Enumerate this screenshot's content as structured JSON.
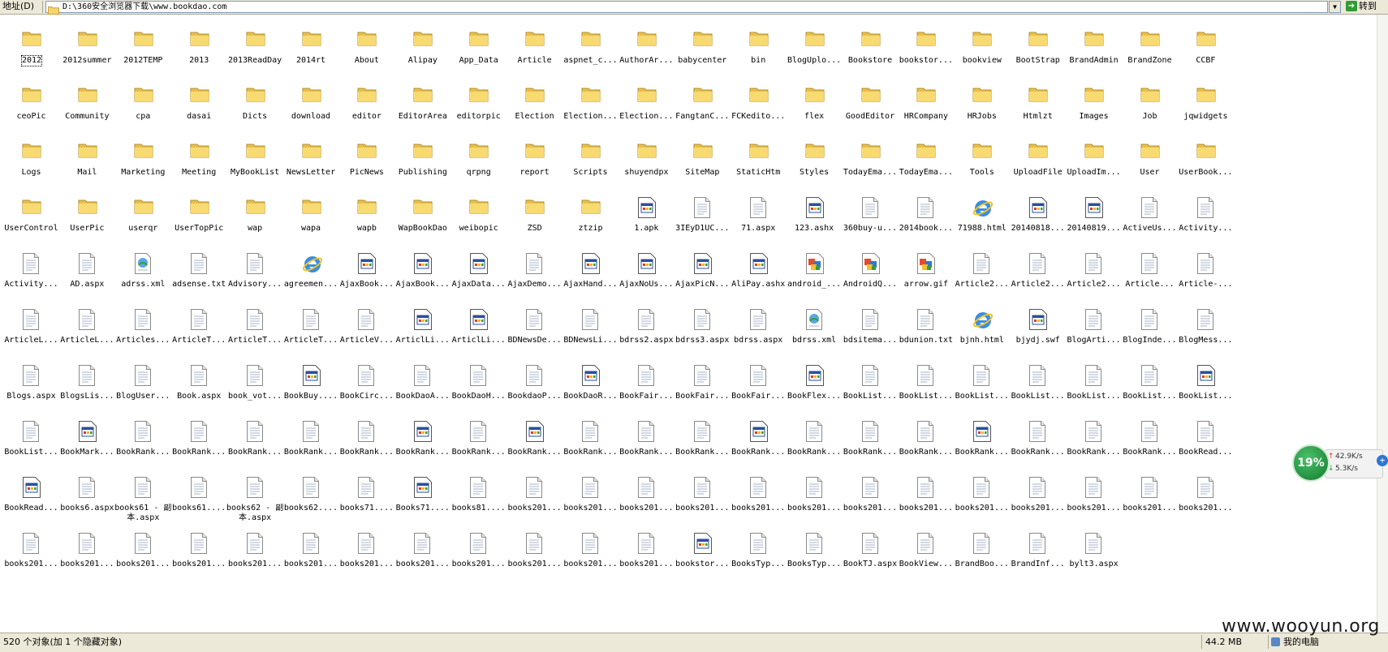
{
  "address_bar": {
    "label": "地址(D)",
    "path": "D:\\360安全浏览器下载\\www.bookdao.com",
    "goto_label": "转到",
    "dropdown_glyph": "▼",
    "goto_glyph": "➔"
  },
  "files": [
    {
      "name": "2012",
      "type": "folder"
    },
    {
      "name": "2012summer",
      "type": "folder"
    },
    {
      "name": "2012TEMP",
      "type": "folder"
    },
    {
      "name": "2013",
      "type": "folder"
    },
    {
      "name": "2013ReadDay",
      "type": "folder"
    },
    {
      "name": "2014rt",
      "type": "folder"
    },
    {
      "name": "About",
      "type": "folder"
    },
    {
      "name": "Alipay",
      "type": "folder"
    },
    {
      "name": "App_Data",
      "type": "folder"
    },
    {
      "name": "Article",
      "type": "folder"
    },
    {
      "name": "aspnet_c...",
      "type": "folder"
    },
    {
      "name": "AuthorAr...",
      "type": "folder"
    },
    {
      "name": "babycenter",
      "type": "folder"
    },
    {
      "name": "bin",
      "type": "folder"
    },
    {
      "name": "BlogUplo...",
      "type": "folder"
    },
    {
      "name": "Bookstore",
      "type": "folder"
    },
    {
      "name": "bookstor...",
      "type": "folder"
    },
    {
      "name": "bookview",
      "type": "folder"
    },
    {
      "name": "BootStrap",
      "type": "folder"
    },
    {
      "name": "BrandAdmin",
      "type": "folder"
    },
    {
      "name": "BrandZone",
      "type": "folder"
    },
    {
      "name": "CCBF",
      "type": "folder"
    },
    {
      "name": "ceoPic",
      "type": "folder"
    },
    {
      "name": "Community",
      "type": "folder"
    },
    {
      "name": "cpa",
      "type": "folder"
    },
    {
      "name": "dasai",
      "type": "folder"
    },
    {
      "name": "Dicts",
      "type": "folder"
    },
    {
      "name": "download",
      "type": "folder"
    },
    {
      "name": "editor",
      "type": "folder"
    },
    {
      "name": "EditorArea",
      "type": "folder"
    },
    {
      "name": "editorpic",
      "type": "folder"
    },
    {
      "name": "Election",
      "type": "folder"
    },
    {
      "name": "Election...",
      "type": "folder"
    },
    {
      "name": "Election...",
      "type": "folder"
    },
    {
      "name": "FangtanC...",
      "type": "folder"
    },
    {
      "name": "FCKedito...",
      "type": "folder"
    },
    {
      "name": "flex",
      "type": "folder"
    },
    {
      "name": "GoodEditor",
      "type": "folder"
    },
    {
      "name": "HRCompany",
      "type": "folder"
    },
    {
      "name": "HRJobs",
      "type": "folder"
    },
    {
      "name": "Htmlzt",
      "type": "folder"
    },
    {
      "name": "Images",
      "type": "folder"
    },
    {
      "name": "Job",
      "type": "folder"
    },
    {
      "name": "jqwidgets",
      "type": "folder"
    },
    {
      "name": "Logs",
      "type": "folder"
    },
    {
      "name": "Mail",
      "type": "folder"
    },
    {
      "name": "Marketing",
      "type": "folder"
    },
    {
      "name": "Meeting",
      "type": "folder"
    },
    {
      "name": "MyBookList",
      "type": "folder"
    },
    {
      "name": "NewsLetter",
      "type": "folder"
    },
    {
      "name": "PicNews",
      "type": "folder"
    },
    {
      "name": "Publishing",
      "type": "folder"
    },
    {
      "name": "qrpng",
      "type": "folder"
    },
    {
      "name": "report",
      "type": "folder"
    },
    {
      "name": "Scripts",
      "type": "folder"
    },
    {
      "name": "shuyendpx",
      "type": "folder"
    },
    {
      "name": "SiteMap",
      "type": "folder"
    },
    {
      "name": "StaticHtm",
      "type": "folder"
    },
    {
      "name": "Styles",
      "type": "folder"
    },
    {
      "name": "TodayEma...",
      "type": "folder"
    },
    {
      "name": "TodayEma...",
      "type": "folder"
    },
    {
      "name": "Tools",
      "type": "folder"
    },
    {
      "name": "UploadFile",
      "type": "folder"
    },
    {
      "name": "UploadIm...",
      "type": "folder"
    },
    {
      "name": "User",
      "type": "folder"
    },
    {
      "name": "UserBook...",
      "type": "folder"
    },
    {
      "name": "UserControl",
      "type": "folder"
    },
    {
      "name": "UserPic",
      "type": "folder"
    },
    {
      "name": "userqr",
      "type": "folder"
    },
    {
      "name": "UserTopPic",
      "type": "folder"
    },
    {
      "name": "wap",
      "type": "folder"
    },
    {
      "name": "wapa",
      "type": "folder"
    },
    {
      "name": "wapb",
      "type": "folder"
    },
    {
      "name": "WapBookDao",
      "type": "folder"
    },
    {
      "name": "weibopic",
      "type": "folder"
    },
    {
      "name": "ZSD",
      "type": "folder"
    },
    {
      "name": "ztzip",
      "type": "folder"
    },
    {
      "name": "1.apk",
      "type": "window"
    },
    {
      "name": "3IEyD1UC...",
      "type": "doc"
    },
    {
      "name": "71.aspx",
      "type": "doc"
    },
    {
      "name": "123.ashx",
      "type": "window"
    },
    {
      "name": "360buy-u...",
      "type": "doc"
    },
    {
      "name": "2014book...",
      "type": "doc"
    },
    {
      "name": "71988.html",
      "type": "ie"
    },
    {
      "name": "20140818...",
      "type": "window"
    },
    {
      "name": "20140819...",
      "type": "window"
    },
    {
      "name": "ActiveUs...",
      "type": "doc"
    },
    {
      "name": "Activity...",
      "type": "doc"
    },
    {
      "name": "Activity...",
      "type": "doc"
    },
    {
      "name": "AD.aspx",
      "type": "doc"
    },
    {
      "name": "adrss.xml",
      "type": "xml"
    },
    {
      "name": "adsense.txt",
      "type": "doc"
    },
    {
      "name": "Advisory...",
      "type": "doc"
    },
    {
      "name": "agreemen...",
      "type": "ie"
    },
    {
      "name": "AjaxBook...",
      "type": "window"
    },
    {
      "name": "AjaxBook...",
      "type": "window"
    },
    {
      "name": "AjaxData...",
      "type": "window"
    },
    {
      "name": "AjaxDemo...",
      "type": "doc"
    },
    {
      "name": "AjaxHand...",
      "type": "window"
    },
    {
      "name": "AjaxNoUs...",
      "type": "window"
    },
    {
      "name": "AjaxPicN...",
      "type": "window"
    },
    {
      "name": "AliPay.ashx",
      "type": "window"
    },
    {
      "name": "android_...",
      "type": "image"
    },
    {
      "name": "AndroidQ...",
      "type": "image"
    },
    {
      "name": "arrow.gif",
      "type": "image"
    },
    {
      "name": "Article2...",
      "type": "doc"
    },
    {
      "name": "Article2...",
      "type": "doc"
    },
    {
      "name": "Article2...",
      "type": "doc"
    },
    {
      "name": "Article...",
      "type": "doc"
    },
    {
      "name": "Article-...",
      "type": "doc"
    },
    {
      "name": "ArticleL...",
      "type": "doc"
    },
    {
      "name": "ArticleL...",
      "type": "doc"
    },
    {
      "name": "Articles...",
      "type": "doc"
    },
    {
      "name": "ArticleT...",
      "type": "doc"
    },
    {
      "name": "ArticleT...",
      "type": "doc"
    },
    {
      "name": "ArticleT...",
      "type": "doc"
    },
    {
      "name": "ArticleV...",
      "type": "doc"
    },
    {
      "name": "ArticlLi...",
      "type": "window"
    },
    {
      "name": "ArticlLi...",
      "type": "window"
    },
    {
      "name": "BDNewsDe...",
      "type": "doc"
    },
    {
      "name": "BDNewsLi...",
      "type": "doc"
    },
    {
      "name": "bdrss2.aspx",
      "type": "doc"
    },
    {
      "name": "bdrss3.aspx",
      "type": "doc"
    },
    {
      "name": "bdrss.aspx",
      "type": "doc"
    },
    {
      "name": "bdrss.xml",
      "type": "xml"
    },
    {
      "name": "bdsitema...",
      "type": "doc"
    },
    {
      "name": "bdunion.txt",
      "type": "doc"
    },
    {
      "name": "bjnh.html",
      "type": "ie"
    },
    {
      "name": "bjydj.swf",
      "type": "window"
    },
    {
      "name": "BlogArti...",
      "type": "doc"
    },
    {
      "name": "BlogInde...",
      "type": "doc"
    },
    {
      "name": "BlogMess...",
      "type": "doc"
    },
    {
      "name": "Blogs.aspx",
      "type": "doc"
    },
    {
      "name": "BlogsLis...",
      "type": "doc"
    },
    {
      "name": "BlogUser...",
      "type": "doc"
    },
    {
      "name": "Book.aspx",
      "type": "doc"
    },
    {
      "name": "book_vot...",
      "type": "doc"
    },
    {
      "name": "BookBuy....",
      "type": "window"
    },
    {
      "name": "BookCirc...",
      "type": "doc"
    },
    {
      "name": "BookDaoA...",
      "type": "doc"
    },
    {
      "name": "BookDaoH...",
      "type": "doc"
    },
    {
      "name": "BookdaoP...",
      "type": "doc"
    },
    {
      "name": "BookDaoR...",
      "type": "window"
    },
    {
      "name": "BookFair...",
      "type": "doc"
    },
    {
      "name": "BookFair...",
      "type": "doc"
    },
    {
      "name": "BookFair...",
      "type": "doc"
    },
    {
      "name": "BookFlex...",
      "type": "window"
    },
    {
      "name": "BookList...",
      "type": "doc"
    },
    {
      "name": "BookList...",
      "type": "doc"
    },
    {
      "name": "BookList...",
      "type": "doc"
    },
    {
      "name": "BookList...",
      "type": "doc"
    },
    {
      "name": "BookList...",
      "type": "doc"
    },
    {
      "name": "BookList...",
      "type": "doc"
    },
    {
      "name": "BookList...",
      "type": "window"
    },
    {
      "name": "BookList...",
      "type": "doc"
    },
    {
      "name": "BookMark...",
      "type": "window"
    },
    {
      "name": "BookRank...",
      "type": "doc"
    },
    {
      "name": "BookRank...",
      "type": "doc"
    },
    {
      "name": "BookRank...",
      "type": "doc"
    },
    {
      "name": "BookRank...",
      "type": "doc"
    },
    {
      "name": "BookRank...",
      "type": "doc"
    },
    {
      "name": "BookRank...",
      "type": "window"
    },
    {
      "name": "BookRank...",
      "type": "doc"
    },
    {
      "name": "BookRank...",
      "type": "window"
    },
    {
      "name": "BookRank...",
      "type": "doc"
    },
    {
      "name": "BookRank...",
      "type": "doc"
    },
    {
      "name": "BookRank...",
      "type": "doc"
    },
    {
      "name": "BookRank...",
      "type": "window"
    },
    {
      "name": "BookRank...",
      "type": "doc"
    },
    {
      "name": "BookRank...",
      "type": "doc"
    },
    {
      "name": "BookRank...",
      "type": "doc"
    },
    {
      "name": "BookRank...",
      "type": "window"
    },
    {
      "name": "BookRank...",
      "type": "doc"
    },
    {
      "name": "BookRank...",
      "type": "doc"
    },
    {
      "name": "BookRank...",
      "type": "doc"
    },
    {
      "name": "BookRead...",
      "type": "doc"
    },
    {
      "name": "BookRead...",
      "type": "window"
    },
    {
      "name": "books6.aspx",
      "type": "doc"
    },
    {
      "name": "books61 - 副本.aspx",
      "type": "doc",
      "wrap": true
    },
    {
      "name": "books61....",
      "type": "doc"
    },
    {
      "name": "books62 - 副本.aspx",
      "type": "doc",
      "wrap": true
    },
    {
      "name": "books62....",
      "type": "doc"
    },
    {
      "name": "books71....",
      "type": "doc"
    },
    {
      "name": "Books71....",
      "type": "window"
    },
    {
      "name": "books81....",
      "type": "doc"
    },
    {
      "name": "books201...",
      "type": "doc"
    },
    {
      "name": "books201...",
      "type": "doc"
    },
    {
      "name": "books201...",
      "type": "doc"
    },
    {
      "name": "books201...",
      "type": "doc"
    },
    {
      "name": "books201...",
      "type": "doc"
    },
    {
      "name": "books201...",
      "type": "doc"
    },
    {
      "name": "books201...",
      "type": "doc"
    },
    {
      "name": "books201...",
      "type": "doc"
    },
    {
      "name": "books201...",
      "type": "doc"
    },
    {
      "name": "books201...",
      "type": "doc"
    },
    {
      "name": "books201...",
      "type": "doc"
    },
    {
      "name": "books201...",
      "type": "doc"
    },
    {
      "name": "books201...",
      "type": "doc"
    },
    {
      "name": "books201...",
      "type": "doc"
    },
    {
      "name": "books201...",
      "type": "doc"
    },
    {
      "name": "books201...",
      "type": "doc"
    },
    {
      "name": "books201...",
      "type": "doc"
    },
    {
      "name": "books201...",
      "type": "doc"
    },
    {
      "name": "books201...",
      "type": "doc"
    },
    {
      "name": "books201...",
      "type": "doc"
    },
    {
      "name": "books201...",
      "type": "doc"
    },
    {
      "name": "books201...",
      "type": "doc"
    },
    {
      "name": "books201...",
      "type": "doc"
    },
    {
      "name": "books201...",
      "type": "doc"
    },
    {
      "name": "books201...",
      "type": "doc"
    },
    {
      "name": "bookstor...",
      "type": "window"
    },
    {
      "name": "BooksTyp...",
      "type": "doc"
    },
    {
      "name": "BooksTyp...",
      "type": "doc"
    },
    {
      "name": "BookTJ.aspx",
      "type": "doc"
    },
    {
      "name": "BookView...",
      "type": "doc"
    },
    {
      "name": "BrandBoo...",
      "type": "doc"
    },
    {
      "name": "BrandInf...",
      "type": "doc"
    },
    {
      "name": "bylt3.aspx",
      "type": "doc"
    }
  ],
  "status_bar": {
    "object_count": "520 个对象(加 1 个隐藏对象)",
    "size": "44.2 MB",
    "zone": "我的电脑"
  },
  "net_monitor": {
    "percent": "19%",
    "upload": "42.9K/s",
    "download": "5.3K/s",
    "expand_glyph": "+"
  },
  "watermark": "www.wooyun.org",
  "colors": {
    "folder_fill": "#f5d56b",
    "folder_edge": "#c9a23a",
    "window_blue": "#2a4f9e",
    "status_bg": "#ece9d8",
    "net_green": "#1e8f3d"
  }
}
